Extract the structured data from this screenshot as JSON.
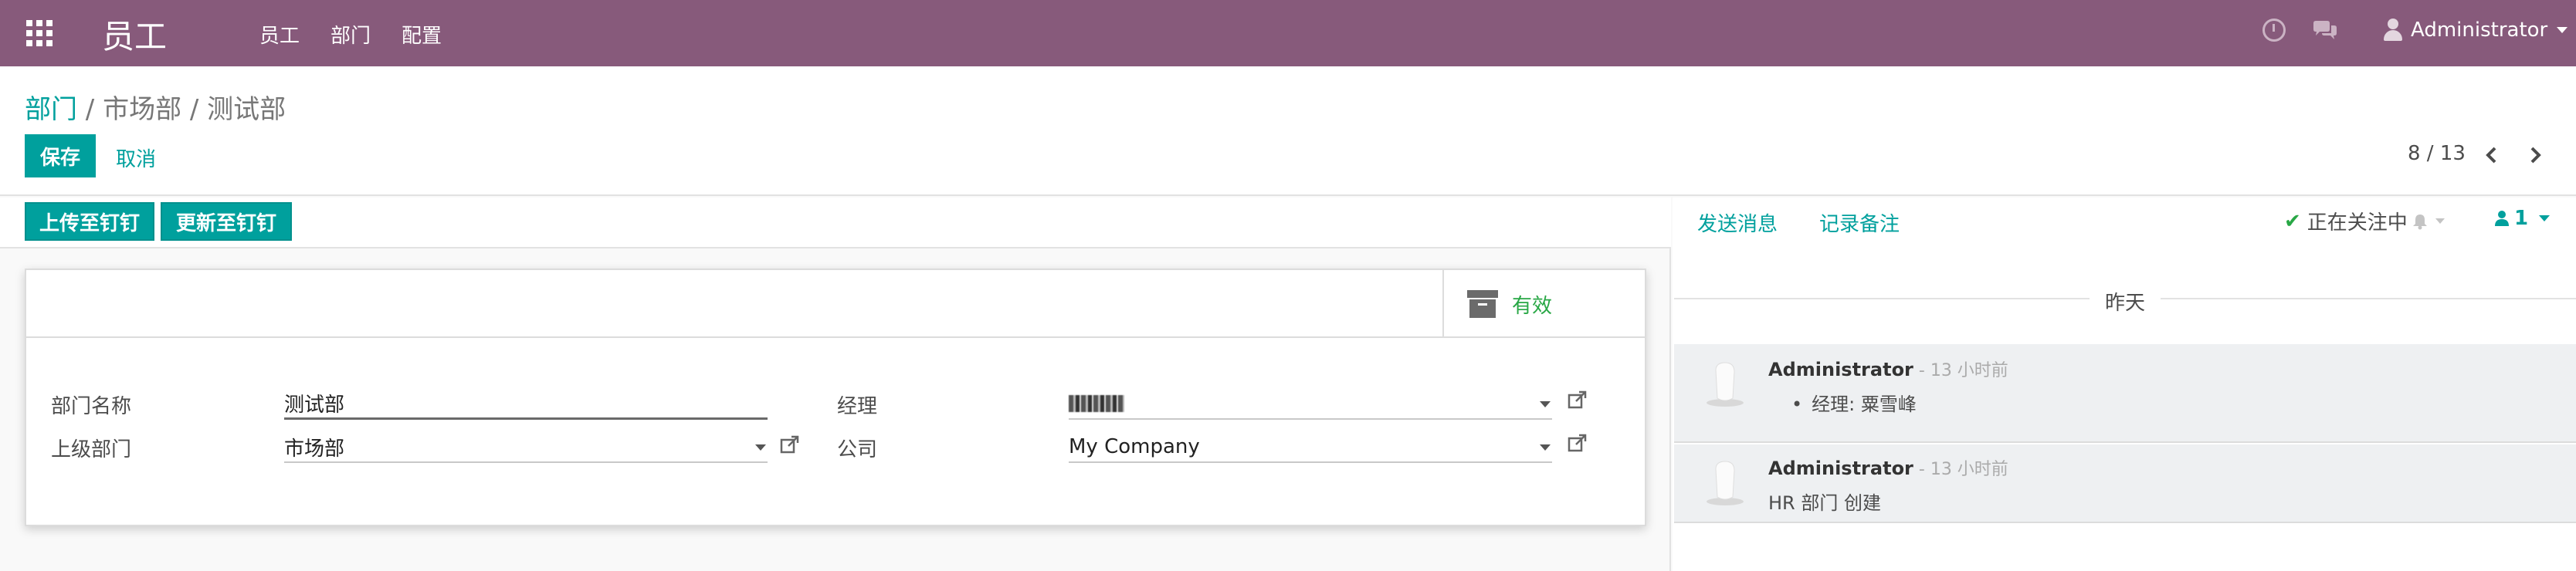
{
  "navbar": {
    "app_title": "员工",
    "menu": [
      "员工",
      "部门",
      "配置"
    ],
    "user": "Administrator"
  },
  "breadcrumb": {
    "root": "部门",
    "sep1": " / ",
    "parent": "市场部",
    "sep2": " / ",
    "current": "测试部"
  },
  "actions": {
    "save": "保存",
    "cancel": "取消"
  },
  "pager": {
    "value": "8 / 13"
  },
  "form_buttons": {
    "upload": "上传至钉钉",
    "update": "更新至钉钉"
  },
  "active_toggle": {
    "label": "有效"
  },
  "fields": {
    "name_label": "部门名称",
    "name_value": "测试部",
    "parent_label": "上级部门",
    "parent_value": "市场部",
    "manager_label": "经理",
    "company_label": "公司",
    "company_value": "My Company"
  },
  "chatter": {
    "send_message": "发送消息",
    "log_note": "记录备注",
    "following": "正在关注中",
    "followers_count": "1",
    "day_label": "昨天",
    "messages": [
      {
        "author": "Administrator",
        "date": " - 13 小时前",
        "body": "经理: 粟雪峰"
      },
      {
        "author": "Administrator",
        "date": " - 13 小时前",
        "body": "HR 部门 创建"
      }
    ]
  },
  "colors": {
    "navbar": "#875a7b",
    "primary": "#00a09d",
    "active": "#28a745"
  }
}
